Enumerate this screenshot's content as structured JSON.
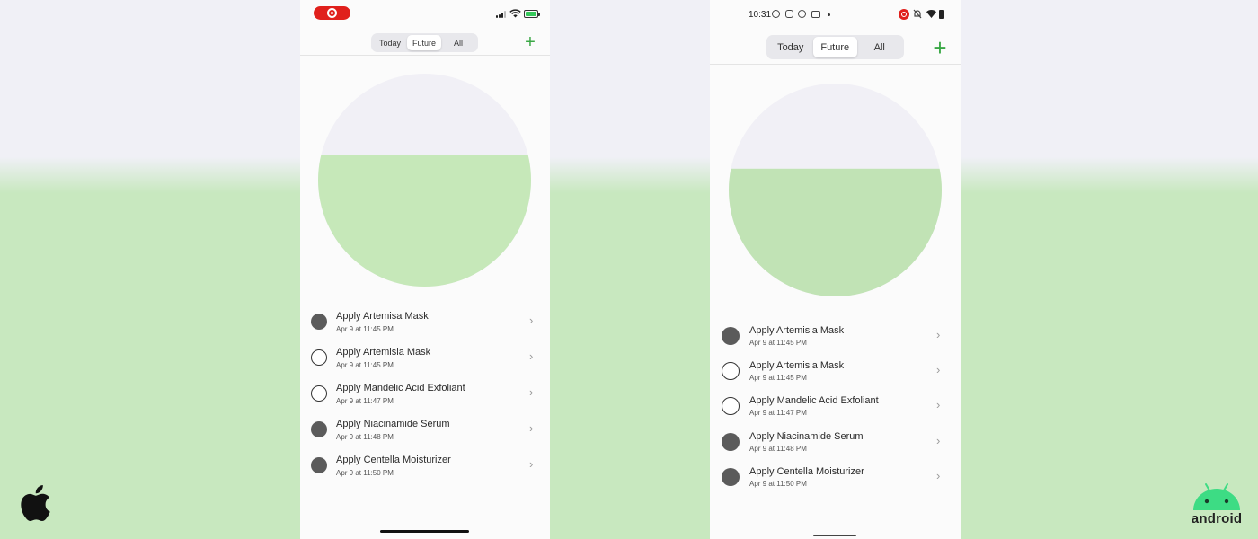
{
  "ios": {
    "tabs": [
      {
        "label": "Today",
        "active": false
      },
      {
        "label": "Future",
        "active": true
      },
      {
        "label": "All",
        "active": false
      }
    ],
    "add_label": "+",
    "progress_fraction_completed": 0.62,
    "colors": {
      "completed_fill": "#c6e8b9",
      "remaining_fill": "#f1f0f6",
      "accent": "#3aa845"
    },
    "tasks": [
      {
        "title": "Apply Artemisa Mask",
        "time": "Apr 9 at 11:45 PM",
        "done": true
      },
      {
        "title": "Apply Artemisia Mask",
        "time": "Apr 9 at 11:45 PM",
        "done": false
      },
      {
        "title": "Apply Mandelic Acid Exfoliant",
        "time": "Apr 9 at 11:47 PM",
        "done": false
      },
      {
        "title": "Apply Niacinamide Serum",
        "time": "Apr 9 at 11:48 PM",
        "done": true
      },
      {
        "title": "Apply Centella Moisturizer",
        "time": "Apr 9 at 11:50 PM",
        "done": true
      }
    ],
    "chevron": "›"
  },
  "android": {
    "status_time": "10:31",
    "tabs": [
      {
        "label": "Today",
        "active": false
      },
      {
        "label": "Future",
        "active": true
      },
      {
        "label": "All",
        "active": false
      }
    ],
    "add_label": "+",
    "progress_fraction_completed": 0.6,
    "colors": {
      "completed_fill": "#c1e3b5",
      "remaining_fill": "#f1f0f6",
      "accent": "#3aa845"
    },
    "tasks": [
      {
        "title": "Apply Artemisia Mask",
        "time": "Apr 9 at 11:45 PM",
        "done": true
      },
      {
        "title": "Apply Artemisia Mask",
        "time": "Apr 9 at 11:45 PM",
        "done": false
      },
      {
        "title": "Apply Mandelic Acid Exfoliant",
        "time": "Apr 9 at 11:47 PM",
        "done": false
      },
      {
        "title": "Apply Niacinamide Serum",
        "time": "Apr 9 at 11:48 PM",
        "done": true
      },
      {
        "title": "Apply Centella Moisturizer",
        "time": "Apr 9 at 11:50 PM",
        "done": true
      }
    ],
    "chevron": "›"
  },
  "platform_logos": {
    "left": "apple-logo",
    "right_word": "android"
  }
}
